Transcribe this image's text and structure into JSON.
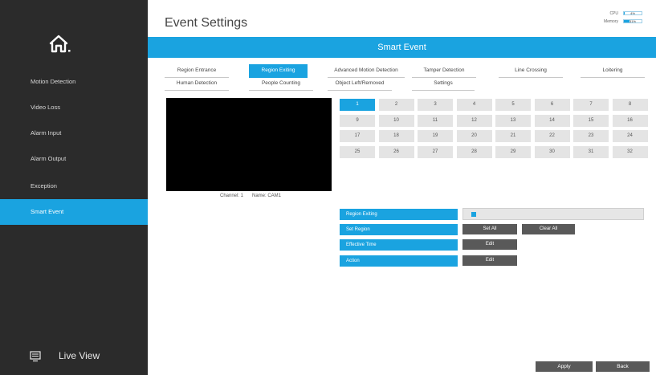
{
  "sidebar": {
    "home_icon": "home-icon",
    "items": [
      {
        "label": "Motion Detection"
      },
      {
        "label": "Video Loss"
      },
      {
        "label": "Alarm Input"
      },
      {
        "label": "Alarm Output"
      },
      {
        "label": "Exception"
      },
      {
        "label": "Smart Event",
        "active": true
      }
    ],
    "live_view": {
      "label": "Live View",
      "icon": "monitor-icon"
    }
  },
  "header": {
    "title": "Event Settings",
    "cpu": {
      "label": "CPU",
      "value": "4%",
      "level": 0.04
    },
    "memory": {
      "label": "Memory",
      "value": "31%",
      "level": 0.31
    }
  },
  "section": {
    "title": "Smart Event"
  },
  "tabs": [
    {
      "label": "Region Entrance"
    },
    {
      "label": "Region Exiting",
      "active": true
    },
    {
      "label": "Advanced Motion Detection"
    },
    {
      "label": "Tamper Detection"
    },
    {
      "label": "Line Crossing"
    },
    {
      "label": "Loitering"
    },
    {
      "label": "Human Detection"
    },
    {
      "label": "People Counting"
    },
    {
      "label": "Object Left/Removed"
    },
    {
      "label": "Settings"
    }
  ],
  "preview": {
    "channel_label": "Channel: 1",
    "name_label": "Name: CAM1"
  },
  "channels": [
    "1",
    "2",
    "3",
    "4",
    "5",
    "6",
    "7",
    "8",
    "9",
    "10",
    "11",
    "12",
    "13",
    "14",
    "15",
    "16",
    "17",
    "18",
    "19",
    "20",
    "21",
    "22",
    "23",
    "24",
    "25",
    "26",
    "27",
    "28",
    "29",
    "30",
    "31",
    "32"
  ],
  "selected_channel": "1",
  "settings": {
    "enable_label": "Region Exiting",
    "enable_checked": true,
    "set_region_label": "Set Region",
    "set_all_button": "Set All",
    "clear_all_button": "Clear All",
    "effective_time_label": "Effective Time",
    "effective_time_button": "Edit",
    "action_label": "Action",
    "action_button": "Edit"
  },
  "footer": {
    "apply_button": "Apply",
    "back_button": "Back"
  },
  "colors": {
    "accent": "#1aa3e0",
    "sidebar_bg": "#2b2b2b",
    "button_bg": "#595959"
  }
}
